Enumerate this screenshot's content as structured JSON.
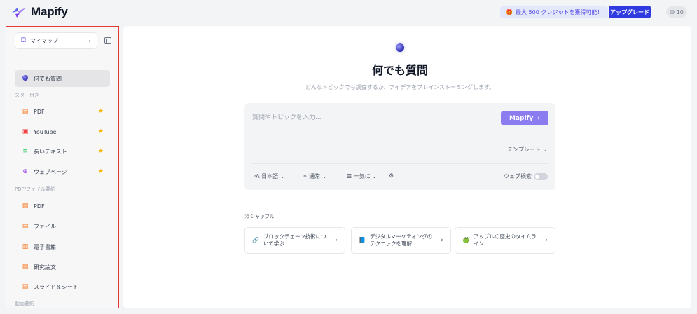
{
  "header": {
    "logo_text": "Mapify",
    "promo_text": "最大 500 クレジットを獲得可能！",
    "upgrade_label": "アップグレード",
    "credits": "10"
  },
  "sidebar": {
    "mymap_label": "マイマップ",
    "ask_label": "何でも質問",
    "starred_heading": "スター付き",
    "starred": [
      {
        "label": "PDF",
        "icon": "pdf-icon"
      },
      {
        "label": "YouTube",
        "icon": "youtube-icon"
      },
      {
        "label": "長いテキスト",
        "icon": "long-text-icon"
      },
      {
        "label": "ウェブページ",
        "icon": "globe-icon"
      }
    ],
    "pdf_heading": "PDF/ファイル要約",
    "files": [
      {
        "label": "PDF",
        "icon": "pdf-icon"
      },
      {
        "label": "ファイル",
        "icon": "file-icon"
      },
      {
        "label": "電子書籍",
        "icon": "ebook-icon"
      },
      {
        "label": "研究論文",
        "icon": "paper-icon"
      },
      {
        "label": "スライド＆シート",
        "icon": "slides-icon"
      }
    ],
    "video_heading": "動画要約"
  },
  "main": {
    "title": "何でも質問",
    "subtitle": "どんなトピックでも調査するか、アイデアをブレインストーミングします。",
    "input_placeholder": "質問やトピックを入力...",
    "submit_label": "Mapify",
    "template_label": "テンプレート",
    "language": "日本語",
    "mode": "通常",
    "output": "一気に",
    "web_search_label": "ウェブ検索",
    "web_search_enabled": false,
    "shuffle_label": "シャッフル",
    "suggestions": [
      {
        "text": "ブロックチェーン技術について学ぶ",
        "icon": "link-icon"
      },
      {
        "text": "デジタルマーケティングのテクニックを理解",
        "icon": "book-icon"
      },
      {
        "text": "アップルの歴史のタイムライン",
        "icon": "apple-icon"
      }
    ]
  },
  "colors": {
    "accent": "#2f3ae0",
    "mapify_button": "#8b7cf0",
    "star": "#f5b400",
    "file_icon": "#f97316",
    "sidebar_highlight_border": "#e53935"
  }
}
